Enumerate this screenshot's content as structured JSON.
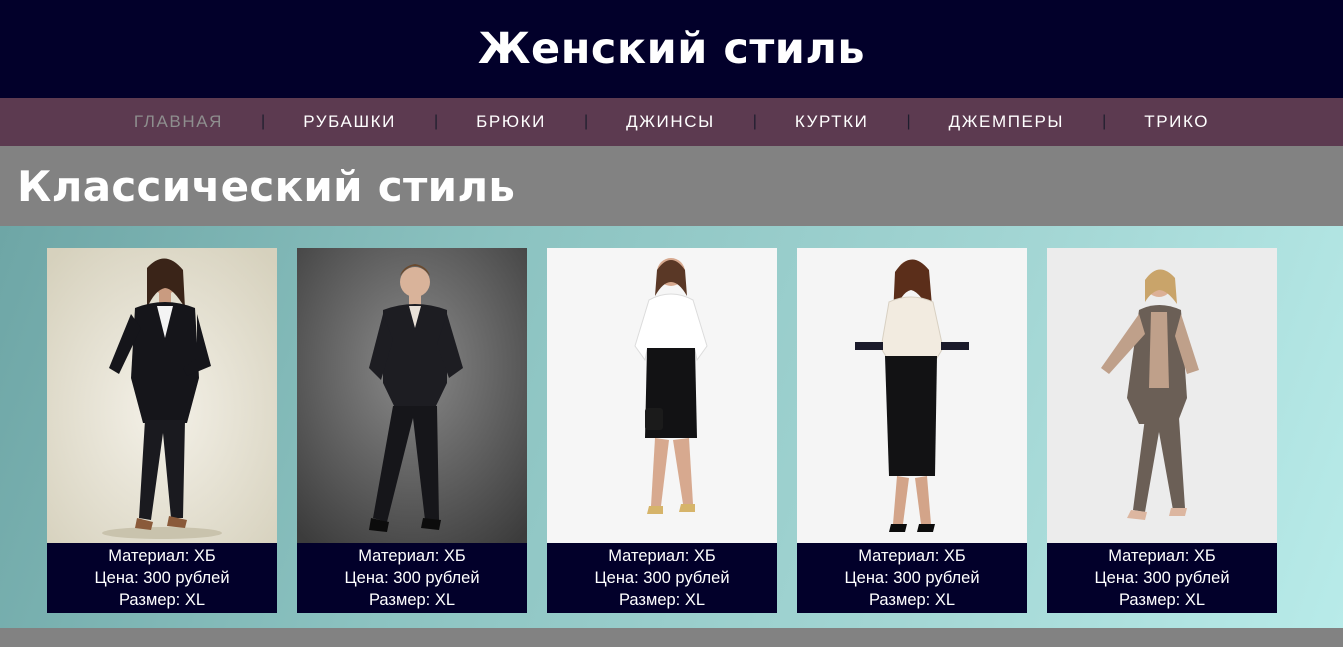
{
  "header": {
    "title": "Женский стиль"
  },
  "nav": {
    "items": [
      {
        "label": "ГЛАВНАЯ",
        "active": true
      },
      {
        "label": "РУБАШКИ",
        "active": false
      },
      {
        "label": "БРЮКИ",
        "active": false
      },
      {
        "label": "ДЖИНСЫ",
        "active": false
      },
      {
        "label": "КУРТКИ",
        "active": false
      },
      {
        "label": "ДЖЕМПЕРЫ",
        "active": false
      },
      {
        "label": "ТРИКО",
        "active": false
      }
    ],
    "separator": "|"
  },
  "section": {
    "title": "Классический стиль"
  },
  "products": [
    {
      "material": "Материал: ХБ",
      "price": "Цена: 300 рублей",
      "size": "Размер: XL"
    },
    {
      "material": "Материал: ХБ",
      "price": "Цена: 300 рублей",
      "size": "Размер: XL"
    },
    {
      "material": "Материал: ХБ",
      "price": "Цена: 300 рублей",
      "size": "Размер: XL"
    },
    {
      "material": "Материал: ХБ",
      "price": "Цена: 300 рублей",
      "size": "Размер: XL"
    },
    {
      "material": "Материал: ХБ",
      "price": "Цена: 300 рублей",
      "size": "Размер: XL"
    }
  ],
  "colors": {
    "header_bg": "#02002a",
    "nav_bg": "#5c3a50",
    "section_bg": "#828282",
    "caption_bg": "#02002a",
    "nav_active": "#8e8e8e"
  }
}
